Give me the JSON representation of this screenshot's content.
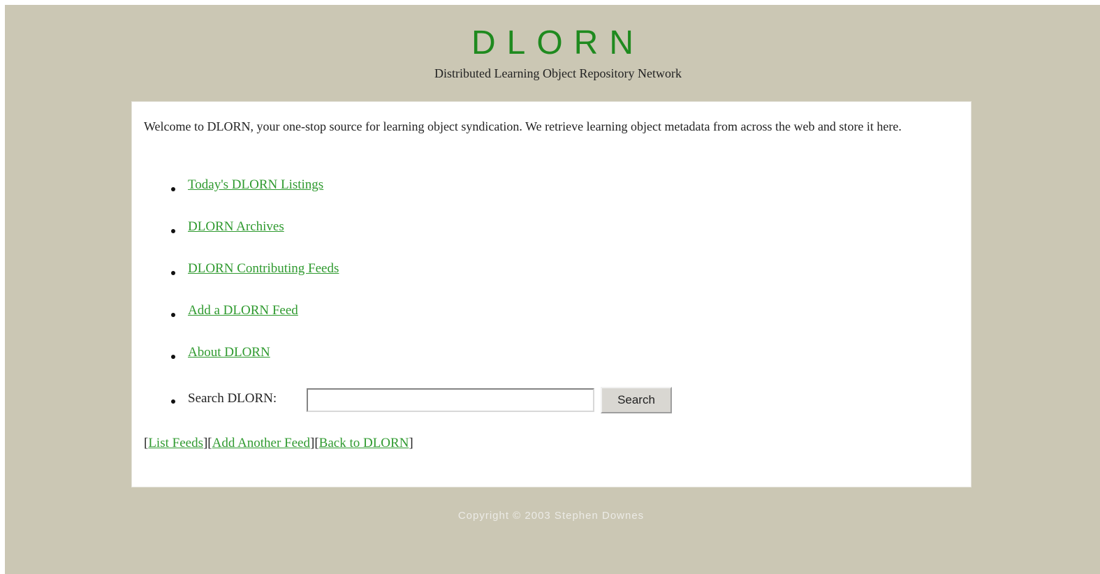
{
  "header": {
    "title": "DLORN",
    "subtitle": "Distributed Learning Object Repository Network"
  },
  "main": {
    "intro": "Welcome to DLORN, your one-stop source for learning object syndication. We retrieve learning object metadata from across the web and store it here.",
    "links": [
      {
        "label": "Today's DLORN Listings"
      },
      {
        "label": "DLORN Archives"
      },
      {
        "label": "DLORN Contributing Feeds"
      },
      {
        "label": "Add a DLORN Feed"
      },
      {
        "label": "About DLORN"
      }
    ],
    "search": {
      "label": "Search DLORN:",
      "value": "",
      "button_label": "Search"
    },
    "footer_links": {
      "open_bracket": "[",
      "list_feeds": "List Feeds",
      "sep1": "][",
      "add_another_feed": "Add Another Feed",
      "sep2": "][",
      "back_to_dlorn": "Back to DLORN",
      "close_bracket": "]"
    }
  },
  "footer": {
    "copyright": "Copyright © 2003 Stephen Downes"
  },
  "colors": {
    "background": "#cbc7b4",
    "title": "#1f8a1f",
    "link": "#2f9a2f"
  }
}
